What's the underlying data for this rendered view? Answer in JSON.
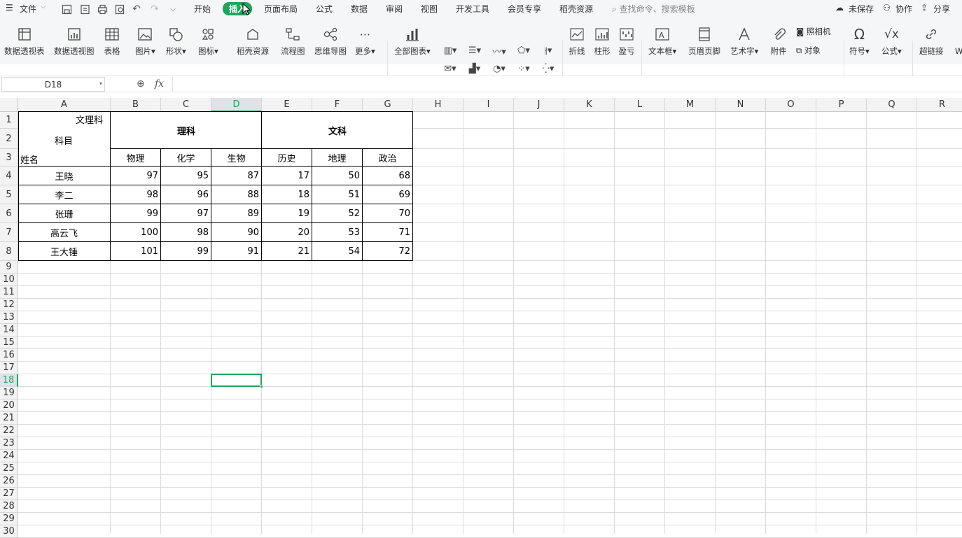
{
  "menubar": {
    "file_label": "文件",
    "tabs": [
      "开始",
      "插入",
      "页面布局",
      "公式",
      "数据",
      "审阅",
      "视图",
      "开发工具",
      "会员专享",
      "稻壳资源"
    ],
    "active_tab": "插入",
    "search_placeholder": "查找命令、搜索模板",
    "unsaved": "未保存",
    "collab": "协作",
    "share": "分享"
  },
  "toolbar": {
    "pivot_table": "数据透视表",
    "pivot_chart": "数据透视图",
    "table": "表格",
    "picture": "图片",
    "shape": "形状",
    "icon": "图标",
    "daoke": "稻壳资源",
    "flowchart": "流程图",
    "mindmap": "思维导图",
    "more": "更多",
    "all_charts": "全部图表",
    "line": "折线",
    "column": "柱形",
    "winloss": "盈亏",
    "textbox": "文本框",
    "header_footer": "页眉页脚",
    "wordart": "艺术字",
    "attachment": "附件",
    "camera": "照相机",
    "object": "对象",
    "symbol": "符号",
    "formula": "公式",
    "hyperlink": "超链接",
    "cut_w": "W"
  },
  "formula_bar": {
    "name_box": "D18",
    "fx": "fx",
    "value": ""
  },
  "columns": [
    "A",
    "B",
    "C",
    "D",
    "E",
    "F",
    "G",
    "H",
    "I",
    "J",
    "K",
    "L",
    "M",
    "N",
    "O",
    "P",
    "Q",
    "R"
  ],
  "selected_col": "D",
  "selected_row": "18",
  "rows": [
    "1",
    "2",
    "3",
    "4",
    "5",
    "6",
    "7",
    "8",
    "9",
    "10",
    "11",
    "12",
    "13",
    "14",
    "15",
    "16",
    "17",
    "18",
    "19",
    "20",
    "21",
    "22",
    "23",
    "24",
    "25",
    "26",
    "27",
    "28",
    "29",
    "30"
  ],
  "sheet": {
    "diag_top": "文理科",
    "diag_mid": "科目",
    "diag_bottom": "姓名",
    "group_science": "理科",
    "group_arts": "文科",
    "subjects": [
      "物理",
      "化学",
      "生物",
      "历史",
      "地理",
      "政治"
    ],
    "students": [
      {
        "name": "王晓",
        "scores": [
          "97",
          "95",
          "87",
          "17",
          "50",
          "68"
        ]
      },
      {
        "name": "李二",
        "scores": [
          "98",
          "96",
          "88",
          "18",
          "51",
          "69"
        ]
      },
      {
        "name": "张珊",
        "scores": [
          "99",
          "97",
          "89",
          "19",
          "52",
          "70"
        ]
      },
      {
        "name": "高云飞",
        "scores": [
          "100",
          "98",
          "90",
          "20",
          "53",
          "71"
        ]
      },
      {
        "name": "王大锤",
        "scores": [
          "101",
          "99",
          "91",
          "21",
          "54",
          "72"
        ]
      }
    ]
  }
}
